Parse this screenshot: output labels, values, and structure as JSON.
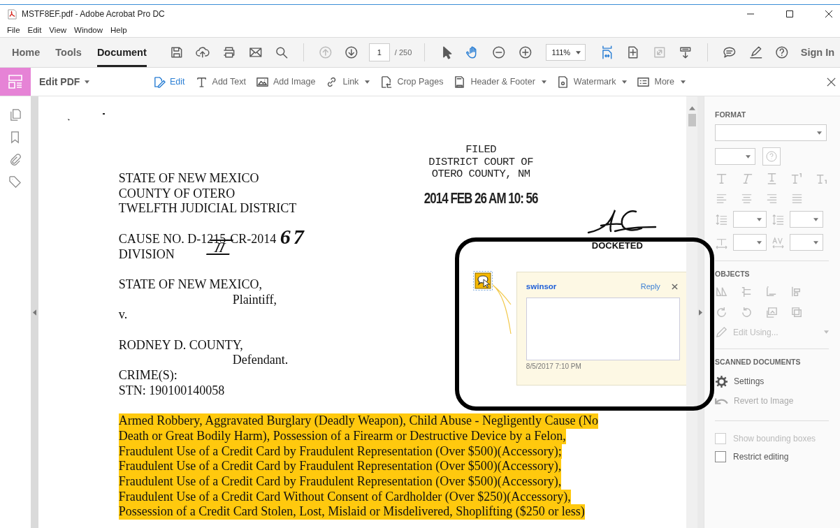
{
  "window": {
    "title": "MSTF8EF.pdf - Adobe Acrobat Pro DC"
  },
  "menu": [
    "File",
    "Edit",
    "View",
    "Window",
    "Help"
  ],
  "tabs": [
    {
      "label": "Home",
      "selected": false
    },
    {
      "label": "Tools",
      "selected": false
    },
    {
      "label": "Document",
      "selected": true
    }
  ],
  "toolbar_buttons": [
    {
      "active": false,
      "disabled": false
    },
    {
      "active": false,
      "disabled": false
    },
    {
      "active": false,
      "disabled": false
    },
    {
      "active": false,
      "disabled": false
    },
    {
      "active": false,
      "disabled": false
    },
    {
      "active": false,
      "disabled": true
    },
    {
      "active": false,
      "disabled": false
    },
    {
      "active": false,
      "disabled": false
    },
    {
      "active": true,
      "disabled": false
    },
    {
      "active": false,
      "disabled": false
    },
    {
      "active": false,
      "disabled": false
    },
    {
      "active": true,
      "disabled": false
    },
    {
      "active": false,
      "disabled": false
    },
    {
      "active": false,
      "disabled": true
    },
    {
      "active": false,
      "disabled": false
    },
    {
      "active": false,
      "disabled": false
    },
    {
      "active": false,
      "disabled": false
    },
    {
      "active": false,
      "disabled": false
    }
  ],
  "page_field": {
    "value": "1",
    "total": "/ 250"
  },
  "zoom_field": {
    "value": "111%"
  },
  "sign_in": "Sign In",
  "edit_bar": {
    "title": "Edit PDF",
    "tools": [
      {
        "label": "Edit",
        "active": true,
        "dropdown": false
      },
      {
        "label": "Add Text",
        "active": false,
        "dropdown": false
      },
      {
        "label": "Add Image",
        "active": false,
        "dropdown": false
      },
      {
        "label": "Link",
        "active": false,
        "dropdown": true
      },
      {
        "label": "Crop Pages",
        "active": false,
        "dropdown": false
      },
      {
        "label": "Header & Footer",
        "active": false,
        "dropdown": true
      },
      {
        "label": "Watermark",
        "active": false,
        "dropdown": true
      },
      {
        "label": "More",
        "active": false,
        "dropdown": true
      }
    ]
  },
  "document": {
    "court": [
      "STATE OF NEW MEXICO",
      "COUNTY OF OTERO",
      "TWELFTH JUDICIAL DISTRICT"
    ],
    "cause": "CAUSE NO. D-1215-CR-2014",
    "cause_handwritten": "67",
    "division": "DIVISION",
    "division_handwritten": "II",
    "plaintiff": [
      {
        "text": "STATE OF NEW MEXICO,",
        "kind": "name"
      },
      {
        "text": "Plaintiff,",
        "kind": "role"
      },
      {
        "text": "v.",
        "kind": "name"
      }
    ],
    "defendant": [
      {
        "text": "RODNEY D. COUNTY,",
        "kind": "name"
      },
      {
        "text": "Defendant.",
        "kind": "role"
      },
      {
        "text": "CRIME(S):",
        "kind": "name"
      },
      {
        "text": "STN:  190100140058",
        "kind": "name"
      }
    ],
    "highlighted_lines": [
      "Armed Robbery, Aggravated Burglary (Deadly Weapon), Child Abuse - Negligently Cause (No",
      "Death or Great Bodily Harm), Possession of a Firearm or Destructive Device by a Felon,",
      "Fraudulent Use of a Credit Card by Fraudulent Representation (Over $500)(Accessory);",
      "Fraudulent Use of a Credit Card by Fraudulent Representation (Over $500)(Accessory),",
      "Fraudulent Use of a Credit Card by Fraudulent Representation (Over $500)(Accessory),",
      "Fraudulent Use of a Credit Card Without Consent of Cardholder (Over $250)(Accessory),",
      "Possession of a Credit Card Stolen, Lost, Mislaid or Misdelivered, Shoplifting ($250 or less)"
    ],
    "stamp": {
      "lines": [
        "FILED",
        "DISTRICT COURT OF",
        "OTERO COUNTY, NM"
      ],
      "date": "2014 FEB 26  AM 10: 56"
    },
    "docketed": "DOCKETED"
  },
  "comment": {
    "author": "swinsor",
    "reply": "Reply",
    "date": "8/5/2017  7:10 PM"
  },
  "panel": {
    "format": {
      "title": "FORMAT",
      "disabled": true
    },
    "objects": {
      "title": "OBJECTS",
      "edit_using": "Edit Using...",
      "disabled": true
    },
    "scanned": {
      "title": "SCANNED DOCUMENTS",
      "items": [
        {
          "label": "Settings",
          "disabled": false
        },
        {
          "label": "Revert to Image",
          "disabled": true
        }
      ]
    },
    "options": [
      {
        "label": "Show bounding boxes",
        "checked": false,
        "disabled": true
      },
      {
        "label": "Restrict editing",
        "checked": false,
        "disabled": false
      }
    ]
  }
}
